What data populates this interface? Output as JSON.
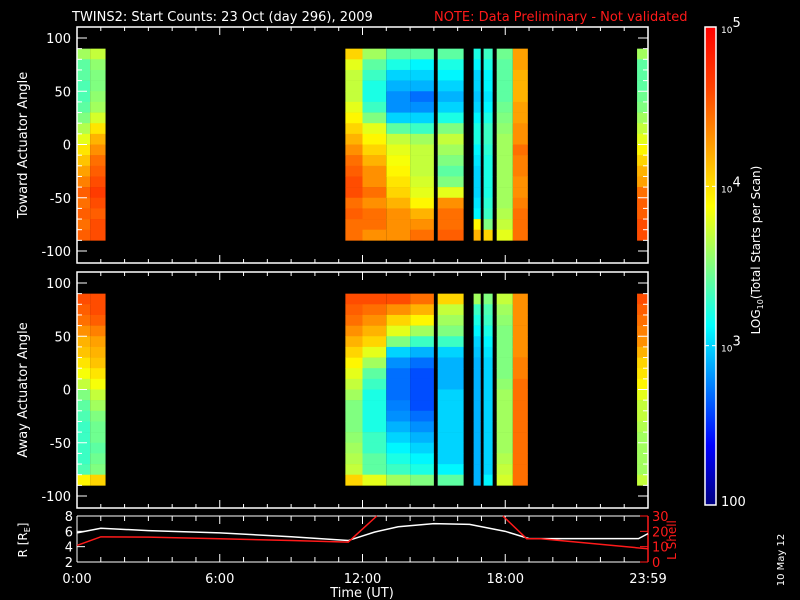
{
  "title": {
    "main": "TWINS2: Start Counts: 23 Oct (day 296), 2009",
    "note": "NOTE: Data Preliminary - Not validated",
    "note_color": "#ff1a1a"
  },
  "side_stamp": "10 May 12",
  "chart_data": {
    "type": "heatmap",
    "x_label": "Time (UT)",
    "x_range_hours": [
      0,
      24
    ],
    "x_ticks": [
      {
        "hour": 0,
        "label": "0:00"
      },
      {
        "hour": 6,
        "label": "6:00"
      },
      {
        "hour": 12,
        "label": "12:00"
      },
      {
        "hour": 18,
        "label": "18:00"
      },
      {
        "hour": 24,
        "label": "23:59"
      }
    ],
    "angle_bin_centers_deg": [
      85,
      75,
      65,
      55,
      45,
      35,
      25,
      15,
      5,
      -5,
      -15,
      -25,
      -35,
      -45,
      -55,
      -65,
      -75,
      -85
    ],
    "colorbar": {
      "label_prefix": "LOG",
      "label_sub": "10",
      "label_suffix": "(Total Starts per Scan)",
      "log_range": [
        2,
        5
      ],
      "ticks": [
        {
          "log": 5,
          "base": "10",
          "exp": "5"
        },
        {
          "log": 4,
          "base": "10",
          "exp": "4"
        },
        {
          "log": 3,
          "base": "10",
          "exp": "3"
        },
        {
          "log": 2,
          "base": "100",
          "exp": ""
        }
      ]
    },
    "panels": [
      {
        "name": "toward",
        "ylabel": "Toward Actuator Angle",
        "y_range": [
          -110,
          110
        ],
        "yticks": [
          100,
          50,
          0,
          -50,
          -100
        ],
        "segments": [
          {
            "t": [
              0.0,
              0.55
            ],
            "log_counts": [
              3.6,
              3.4,
              3.4,
              3.35,
              3.35,
              3.4,
              3.5,
              3.65,
              3.8,
              3.95,
              4.05,
              4.15,
              4.25,
              4.35,
              4.3,
              4.35,
              4.3,
              4.35
            ]
          },
          {
            "t": [
              0.55,
              1.2
            ],
            "log_counts": [
              3.7,
              3.55,
              3.5,
              3.5,
              3.55,
              3.6,
              3.75,
              3.95,
              4.1,
              4.2,
              4.3,
              4.35,
              4.4,
              4.45,
              4.4,
              4.35,
              4.4,
              4.4
            ]
          },
          {
            "t": [
              11.28,
              12.0
            ],
            "log_counts": [
              4.0,
              3.8,
              3.7,
              3.7,
              3.7,
              3.8,
              3.9,
              4.0,
              4.1,
              4.2,
              4.3,
              4.35,
              4.4,
              4.4,
              4.3,
              4.35,
              4.3,
              4.3
            ]
          },
          {
            "t": [
              12.0,
              13.0
            ],
            "log_counts": [
              3.6,
              3.4,
              3.3,
              3.2,
              3.2,
              3.3,
              3.5,
              3.8,
              3.9,
              4.0,
              4.1,
              4.2,
              4.2,
              4.3,
              4.2,
              4.3,
              4.3,
              4.2
            ]
          },
          {
            "t": [
              13.0,
              14.0
            ],
            "log_counts": [
              3.4,
              3.2,
              3.0,
              2.9,
              2.8,
              2.8,
              3.0,
              3.4,
              3.7,
              3.8,
              3.85,
              3.9,
              3.95,
              4.0,
              4.1,
              4.2,
              4.2,
              4.2
            ]
          },
          {
            "t": [
              14.0,
              15.0
            ],
            "log_counts": [
              3.4,
              3.1,
              3.0,
              2.9,
              2.7,
              2.8,
              3.0,
              3.3,
              3.6,
              3.7,
              3.7,
              3.7,
              3.75,
              3.8,
              3.9,
              4.1,
              4.2,
              4.3
            ]
          },
          {
            "t": [
              15.16,
              16.25
            ],
            "log_counts": [
              3.4,
              3.2,
              3.1,
              3.0,
              2.9,
              3.0,
              3.2,
              3.5,
              3.7,
              3.6,
              3.5,
              3.4,
              3.5,
              3.8,
              4.2,
              4.3,
              4.3,
              4.35
            ]
          },
          {
            "t": [
              16.67,
              16.97
            ],
            "log_counts": [
              3.2,
              3.1,
              3.0,
              3.0,
              2.95,
              3.0,
              3.1,
              3.2,
              3.2,
              3.1,
              3.05,
              3.0,
              3.0,
              3.0,
              3.05,
              3.1,
              3.9,
              4.1
            ]
          },
          {
            "t": [
              17.09,
              17.47
            ],
            "log_counts": [
              3.3,
              3.2,
              3.1,
              3.1,
              3.05,
              3.1,
              3.2,
              3.3,
              3.3,
              3.25,
              3.2,
              3.2,
              3.2,
              3.2,
              3.25,
              3.3,
              3.5,
              4.0
            ]
          },
          {
            "t": [
              17.64,
              18.32
            ],
            "log_counts": [
              3.45,
              3.4,
              3.4,
              3.4,
              3.4,
              3.45,
              3.5,
              3.55,
              3.6,
              3.6,
              3.6,
              3.6,
              3.6,
              3.6,
              3.6,
              3.65,
              3.7,
              3.8
            ]
          },
          {
            "t": [
              18.32,
              18.95
            ],
            "log_counts": [
              4.15,
              4.15,
              4.1,
              4.1,
              4.1,
              4.15,
              4.15,
              4.2,
              4.2,
              4.3,
              4.25,
              4.25,
              4.2,
              4.2,
              4.25,
              4.3,
              4.3,
              4.3
            ]
          },
          {
            "t": [
              23.54,
              24.0
            ],
            "log_counts": [
              3.6,
              3.4,
              3.4,
              3.4,
              3.45,
              3.5,
              3.6,
              3.7,
              3.8,
              3.9,
              4.0,
              4.1,
              4.15,
              4.3,
              4.35,
              4.35,
              4.4,
              4.4
            ]
          }
        ]
      },
      {
        "name": "away",
        "ylabel": "Away Actuator Angle",
        "y_range": [
          -110,
          110
        ],
        "yticks": [
          100,
          50,
          0,
          -50,
          -100
        ],
        "segments": [
          {
            "t": [
              0.0,
              0.55
            ],
            "log_counts": [
              4.4,
              4.35,
              4.3,
              4.2,
              4.1,
              4.05,
              3.95,
              3.85,
              3.7,
              3.5,
              3.4,
              3.35,
              3.3,
              3.3,
              3.3,
              3.3,
              3.35,
              3.9
            ]
          },
          {
            "t": [
              0.55,
              1.2
            ],
            "log_counts": [
              4.4,
              4.4,
              4.35,
              4.25,
              4.15,
              4.1,
              4.05,
              3.95,
              3.85,
              3.7,
              3.6,
              3.5,
              3.45,
              3.45,
              3.4,
              3.45,
              3.5,
              4.0
            ]
          },
          {
            "t": [
              11.28,
              12.0
            ],
            "log_counts": [
              4.4,
              4.35,
              4.3,
              4.2,
              4.1,
              4.0,
              3.9,
              3.8,
              3.7,
              3.6,
              3.5,
              3.5,
              3.5,
              3.55,
              3.6,
              3.65,
              3.7,
              4.0
            ]
          },
          {
            "t": [
              12.0,
              13.0
            ],
            "log_counts": [
              4.4,
              4.3,
              4.2,
              4.1,
              4.0,
              3.8,
              3.6,
              3.4,
              3.3,
              3.2,
              3.2,
              3.2,
              3.2,
              3.3,
              3.3,
              3.4,
              3.4,
              3.8
            ]
          },
          {
            "t": [
              13.0,
              14.0
            ],
            "log_counts": [
              4.4,
              4.2,
              4.0,
              3.8,
              3.5,
              3.0,
              2.8,
              2.7,
              2.7,
              2.7,
              2.75,
              2.8,
              2.9,
              3.0,
              3.1,
              3.2,
              3.3,
              3.6
            ]
          },
          {
            "t": [
              14.0,
              15.0
            ],
            "log_counts": [
              4.3,
              4.1,
              3.9,
              3.6,
              3.3,
              2.9,
              2.7,
              2.6,
              2.6,
              2.6,
              2.6,
              2.7,
              2.8,
              2.9,
              3.0,
              3.1,
              3.2,
              3.5
            ]
          },
          {
            "t": [
              15.16,
              16.25
            ],
            "log_counts": [
              4.0,
              3.7,
              3.6,
              3.5,
              3.3,
              3.0,
              2.9,
              2.9,
              2.9,
              3.0,
              3.0,
              3.0,
              3.0,
              3.0,
              3.0,
              3.0,
              3.1,
              3.4
            ]
          },
          {
            "t": [
              16.67,
              16.97
            ],
            "log_counts": [
              3.6,
              3.3,
              3.2,
              3.1,
              3.0,
              2.95,
              2.9,
              2.9,
              2.9,
              2.9,
              2.9,
              2.9,
              2.9,
              2.9,
              2.9,
              2.9,
              2.9,
              2.9
            ]
          },
          {
            "t": [
              17.09,
              17.47
            ],
            "log_counts": [
              3.5,
              3.35,
              3.3,
              3.2,
              3.1,
              3.05,
              3.0,
              3.0,
              3.0,
              3.0,
              3.0,
              3.0,
              3.0,
              3.0,
              3.0,
              3.0,
              3.0,
              3.1
            ]
          },
          {
            "t": [
              17.64,
              18.32
            ],
            "log_counts": [
              3.7,
              3.6,
              3.55,
              3.5,
              3.5,
              3.5,
              3.5,
              3.5,
              3.55,
              3.6,
              3.6,
              3.6,
              3.6,
              3.6,
              3.6,
              3.65,
              3.7,
              3.75
            ]
          },
          {
            "t": [
              18.32,
              18.95
            ],
            "log_counts": [
              4.2,
              4.2,
              4.2,
              4.2,
              4.2,
              4.2,
              4.25,
              4.25,
              4.3,
              4.3,
              4.3,
              4.3,
              4.3,
              4.3,
              4.3,
              4.3,
              4.3,
              4.3
            ]
          },
          {
            "t": [
              23.54,
              24.0
            ],
            "log_counts": [
              4.4,
              4.35,
              4.3,
              4.25,
              4.2,
              4.1,
              4.0,
              3.95,
              3.9,
              3.8,
              3.7,
              3.7,
              3.65,
              3.6,
              3.6,
              3.6,
              3.6,
              3.7
            ]
          }
        ]
      }
    ],
    "orbit": {
      "type": "line",
      "r_label_prefix": "R [R",
      "r_label_sub": "E",
      "r_label_suffix": "]",
      "r_range": [
        2,
        8
      ],
      "r_ticks": [
        8,
        6,
        4,
        2
      ],
      "l_label": "L Shell",
      "l_range": [
        0,
        30
      ],
      "l_ticks": [
        30,
        20,
        10,
        0
      ],
      "l_color": "#ff1a1a",
      "r_series": {
        "hours": [
          0,
          1.0,
          3,
          6,
          9,
          11.4,
          12.5,
          13.5,
          15,
          16.5,
          18,
          19,
          23.6,
          24
        ],
        "values": [
          5.8,
          6.4,
          6.1,
          5.8,
          5.3,
          4.8,
          5.9,
          6.6,
          7.0,
          6.9,
          6.0,
          5.05,
          5.05,
          5.7
        ]
      },
      "l_series": [
        {
          "hours": [
            0,
            1.0,
            3,
            6,
            9,
            11.4,
            12.6
          ],
          "values": [
            10.8,
            16.4,
            16.2,
            15.2,
            14.0,
            13.0,
            30
          ]
        },
        {
          "hours": [
            17.9,
            18.9,
            19.5,
            24
          ],
          "values": [
            30,
            15.2,
            15.2,
            8.6
          ]
        }
      ]
    }
  }
}
